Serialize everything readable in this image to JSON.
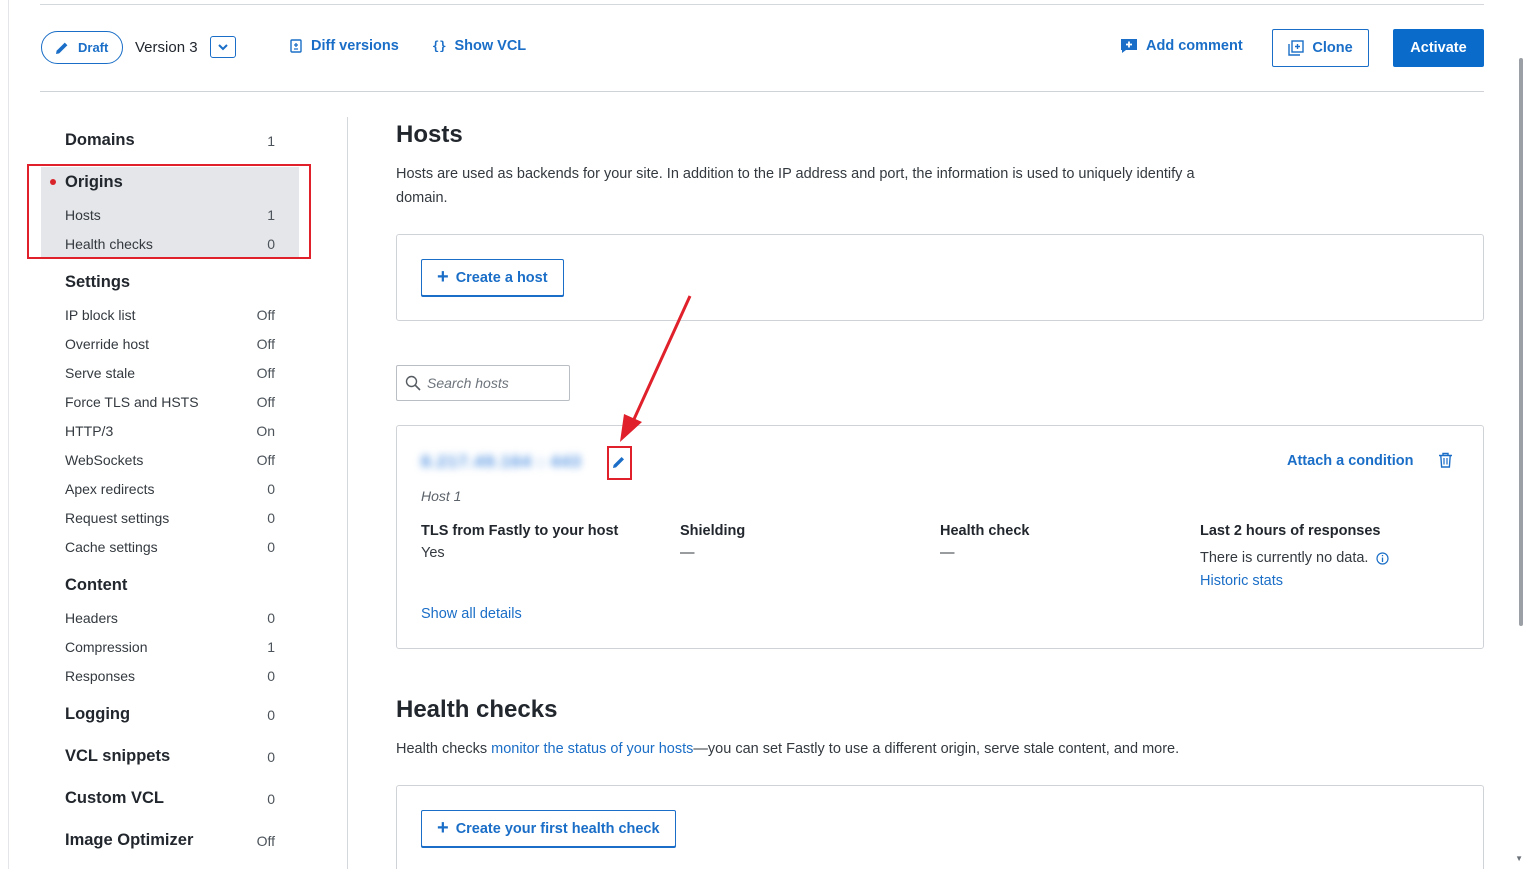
{
  "header": {
    "draft_label": "Draft",
    "version_label": "Version 3",
    "diff_label": "Diff versions",
    "vcl_glyph": "{}",
    "vcl_label": "Show VCL",
    "comment_label": "Add comment",
    "clone_label": "Clone",
    "activate_label": "Activate"
  },
  "sidebar": {
    "domains": {
      "label": "Domains",
      "value": "1"
    },
    "origins": {
      "label": "Origins",
      "items": [
        {
          "label": "Hosts",
          "value": "1"
        },
        {
          "label": "Health checks",
          "value": "0"
        }
      ]
    },
    "settings": {
      "label": "Settings",
      "items": [
        {
          "label": "IP block list",
          "value": "Off"
        },
        {
          "label": "Override host",
          "value": "Off"
        },
        {
          "label": "Serve stale",
          "value": "Off"
        },
        {
          "label": "Force TLS and HSTS",
          "value": "Off"
        },
        {
          "label": "HTTP/3",
          "value": "On"
        },
        {
          "label": "WebSockets",
          "value": "Off"
        },
        {
          "label": "Apex redirects",
          "value": "0"
        },
        {
          "label": "Request settings",
          "value": "0"
        },
        {
          "label": "Cache settings",
          "value": "0"
        }
      ]
    },
    "content": {
      "label": "Content",
      "items": [
        {
          "label": "Headers",
          "value": "0"
        },
        {
          "label": "Compression",
          "value": "1"
        },
        {
          "label": "Responses",
          "value": "0"
        }
      ]
    },
    "logging": {
      "label": "Logging",
      "value": "0"
    },
    "vcl_snippets": {
      "label": "VCL snippets",
      "value": "0"
    },
    "custom_vcl": {
      "label": "Custom VCL",
      "value": "0"
    },
    "image_optimizer": {
      "label": "Image Optimizer",
      "value": "Off"
    }
  },
  "hosts": {
    "title": "Hosts",
    "description": "Hosts are used as backends for your site. In addition to the IP address and port, the information is used to uniquely identify a domain.",
    "create_label": "Create a host",
    "search_placeholder": "Search hosts",
    "host": {
      "address": "8.217.49.164 : 443",
      "name": "Host 1",
      "attach_label": "Attach a condition",
      "tls_label": "TLS from Fastly to your host",
      "tls_value": "Yes",
      "shielding_label": "Shielding",
      "shielding_value": "—",
      "health_label": "Health check",
      "health_value": "—",
      "responses_label": "Last 2 hours of responses",
      "responses_value": "There is currently no data.",
      "historic_label": "Historic stats",
      "details_label": "Show all details"
    }
  },
  "health_checks": {
    "title": "Health checks",
    "desc_before": "Health checks ",
    "desc_link": "monitor the status of your hosts",
    "desc_after": "—you can set Fastly to use a different origin, serve stale content, and more.",
    "create_label": "Create your first health check"
  },
  "colors": {
    "accent": "#1a6ec7",
    "primary_button": "#0b6bcb",
    "annotation_red": "#e0202a",
    "selected_bg": "#e4e6e9"
  }
}
